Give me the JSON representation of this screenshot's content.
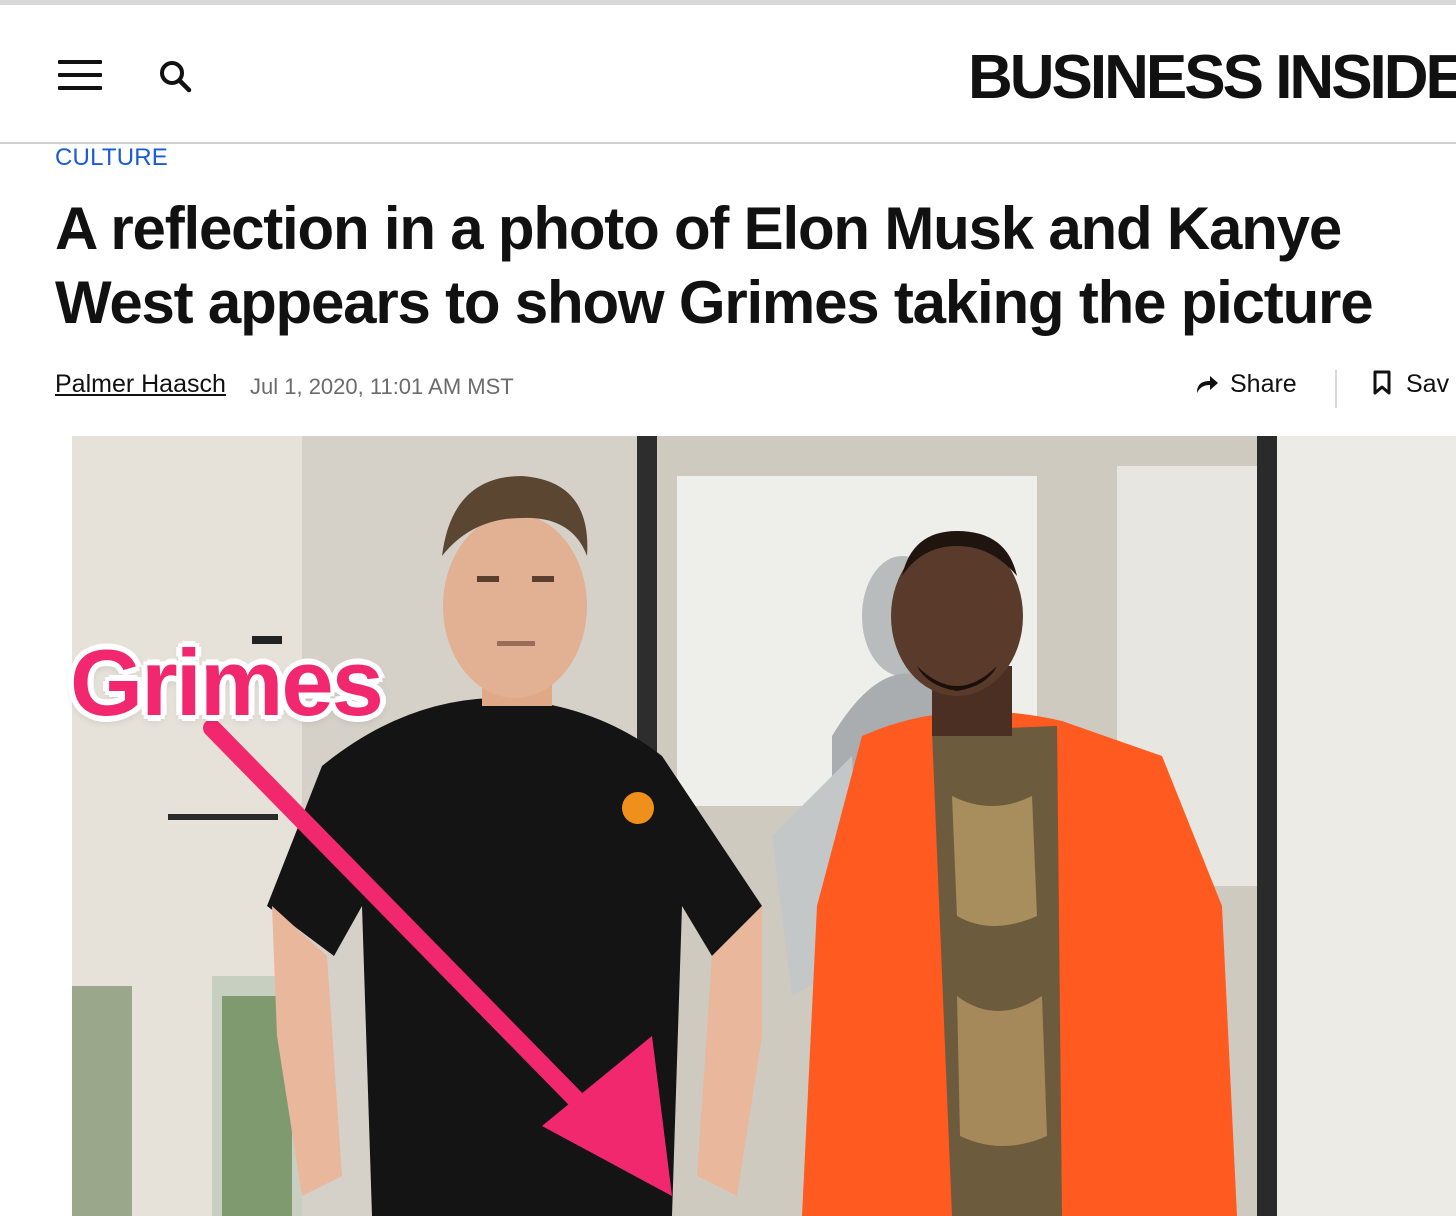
{
  "header": {
    "logo_text": "BUSINESS INSIDE",
    "menu_icon": "hamburger-menu-icon",
    "search_icon": "search-icon"
  },
  "article": {
    "category": "CULTURE",
    "headline_line1": "A reflection in a photo of Elon Musk and Kanye",
    "headline_line2": "West appears to show Grimes taking the picture",
    "author": "Palmer Haasch",
    "date": "Jul 1, 2020, 11:01 AM MST"
  },
  "actions": {
    "share_label": "Share",
    "share_icon": "share-arrow-icon",
    "save_label": "Sav",
    "save_icon": "bookmark-icon"
  },
  "photo": {
    "annotation_label": "Grimes",
    "annotation_color": "#f2286f",
    "accent_orange": "#ff5a1f"
  },
  "colors": {
    "category_link": "#1a5bd8",
    "text": "#111111",
    "meta_gray": "#6b6b6b"
  }
}
